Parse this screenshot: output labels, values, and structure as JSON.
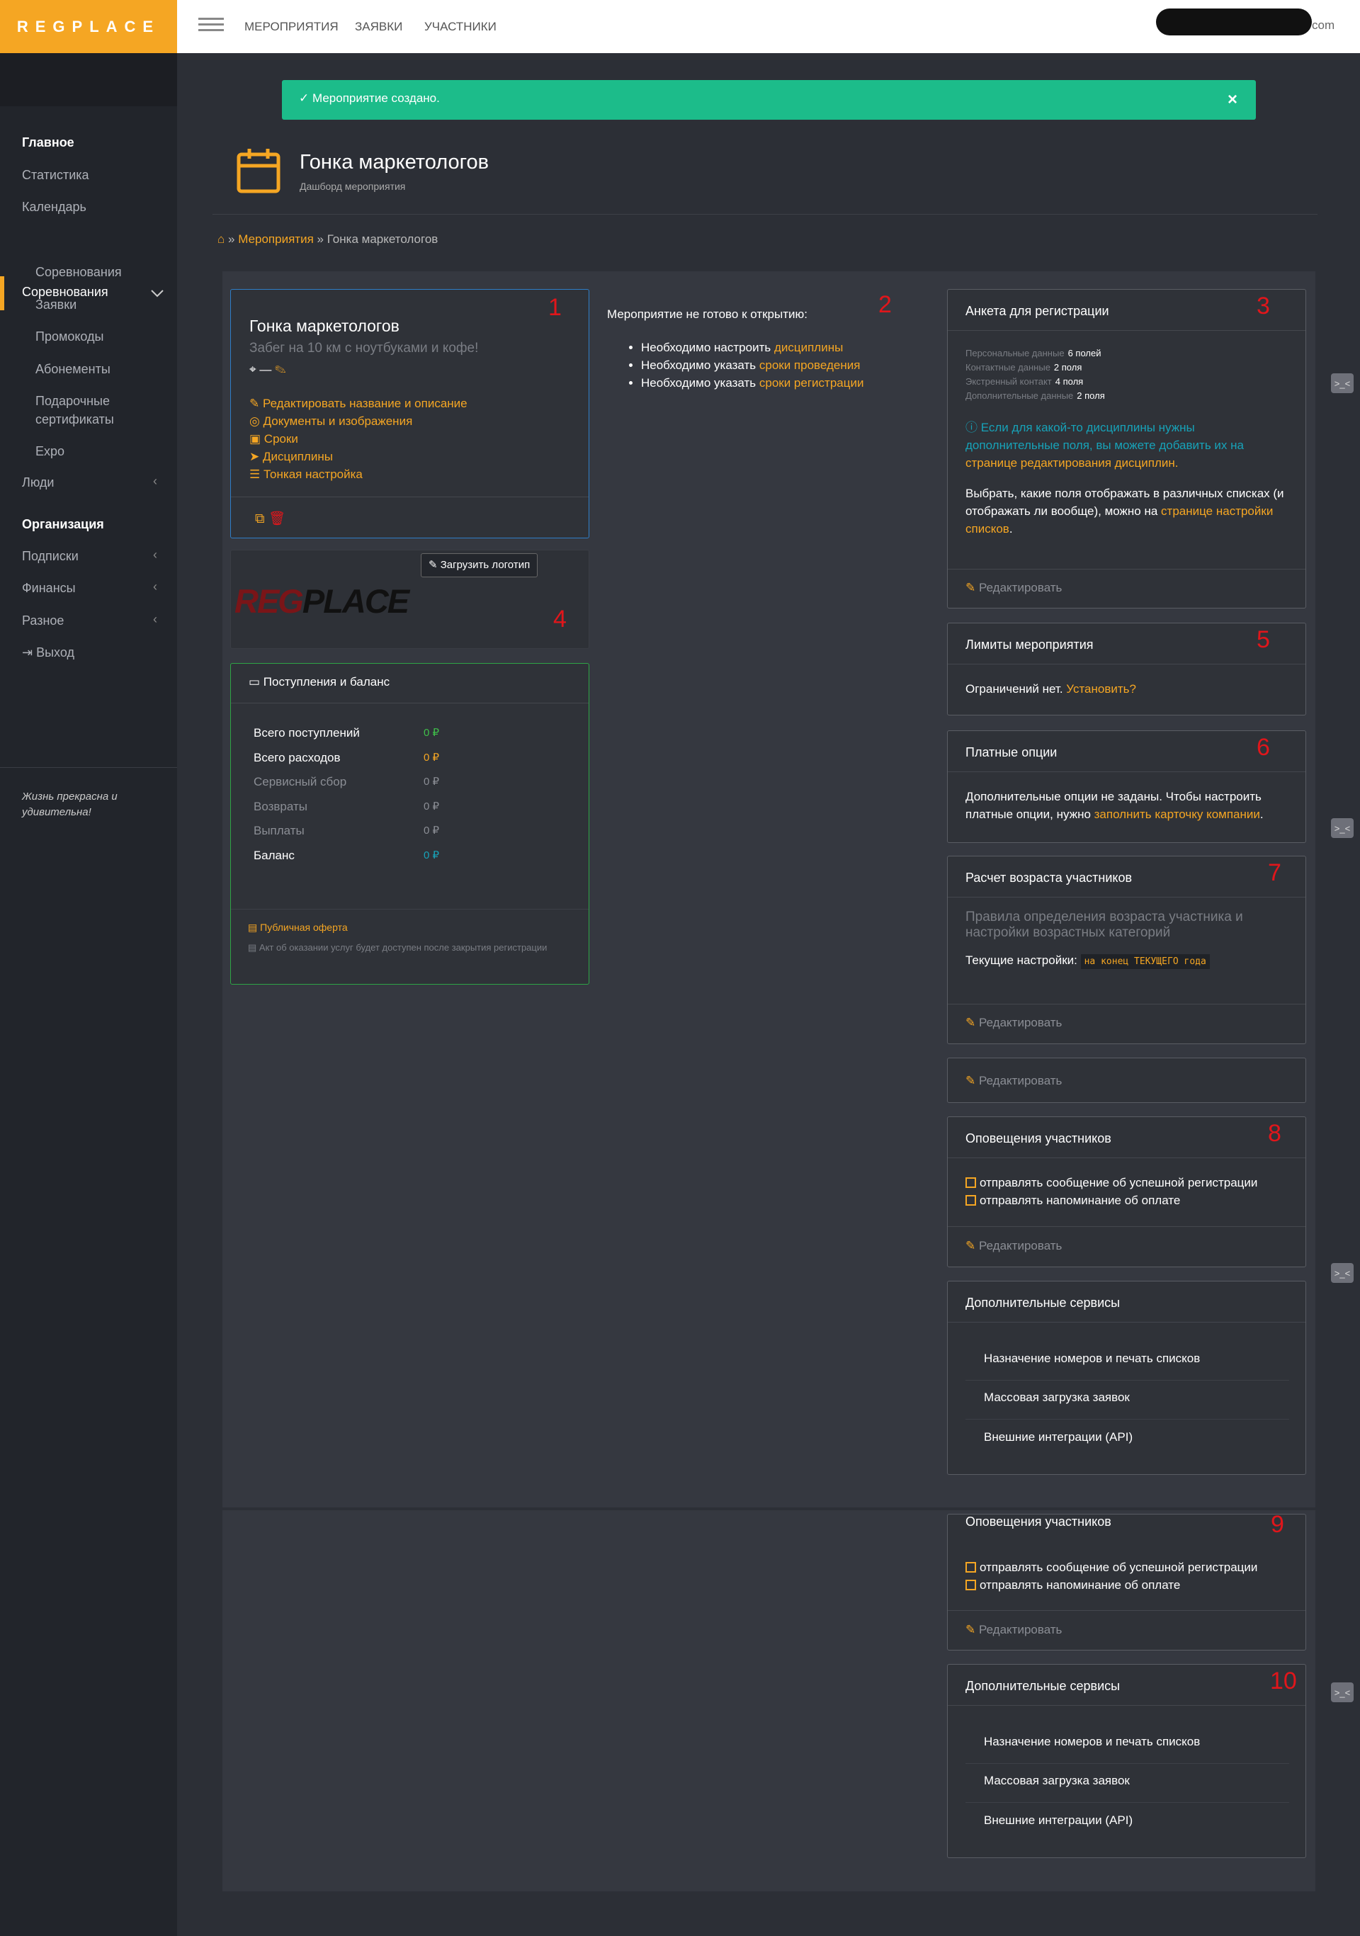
{
  "brand": {
    "logo_text": "REGPLACE",
    "accent": "#f5a623",
    "success": "#1cbc8a",
    "danger": "#e0161b"
  },
  "topnav": {
    "items": [
      "МЕРОПРИЯТИЯ",
      "ЗАЯВКИ",
      "УЧАСТНИКИ"
    ],
    "user_suffix": "com"
  },
  "sidebar": {
    "main": "Главное",
    "items": [
      "Статистика",
      "Календарь"
    ],
    "competitions": "Соревнования",
    "sub": [
      "Соревнования",
      "Заявки",
      "Промокоды",
      "Абонементы",
      "Подарочные сертификаты",
      "Expo"
    ],
    "people": "Люди",
    "org": "Организация",
    "org_items": [
      "Подписки",
      "Финансы",
      "Разное"
    ],
    "logout": "Выход",
    "footer": "Жизнь прекрасна и удивительна!"
  },
  "alert": {
    "text": "Мероприятие создано.",
    "close": "×"
  },
  "page": {
    "title": "Гонка маркетологов",
    "subtitle": "Дашборд мероприятия"
  },
  "breadcrumb": {
    "home_icon": "home-icon",
    "link": "Мероприятия",
    "current": "Гонка маркетологов",
    "sep": "»"
  },
  "event_card": {
    "title": "Гонка маркетологов",
    "desc": "Забег на 10 км с ноутбуками и кофе!",
    "location": "—",
    "links": [
      "Редактировать название и описание",
      "Документы и изображения",
      "Сроки",
      "Дисциплины",
      "Тонкая настройка"
    ]
  },
  "logo_card": {
    "upload_label": "Загрузить логотип",
    "logo_red": "REG",
    "logo_dark": "PLACE"
  },
  "balance": {
    "title": "Поступления и баланс",
    "rows": [
      {
        "label": "Всего поступлений",
        "value": "0 ₽",
        "color": "#3fbf4a"
      },
      {
        "label": "Всего расходов",
        "value": "0 ₽",
        "color": "#f5a623"
      },
      {
        "label": "Сервисный сбор",
        "value": "0 ₽",
        "color": "#8b8e95"
      },
      {
        "label": "Возвраты",
        "value": "0 ₽",
        "color": "#8b8e95"
      },
      {
        "label": "Выплаты",
        "value": "0 ₽",
        "color": "#8b8e95"
      },
      {
        "label": "Баланс",
        "value": "0 ₽",
        "color": "#17a2b8"
      }
    ],
    "offer": "Публичная оферта",
    "act": "Акт об оказании услуг будет доступен после закрытия регистрации"
  },
  "readiness": {
    "title": "Мероприятие не готово к открытию:",
    "items": [
      {
        "text": "Необходимо настроить ",
        "link": "дисциплины"
      },
      {
        "text": "Необходимо указать ",
        "link": "сроки проведения"
      },
      {
        "text": "Необходимо указать ",
        "link": "сроки регистрации"
      }
    ]
  },
  "form_card": {
    "title": "Анкета для регистрации",
    "fields": [
      {
        "label": "Персональные данные",
        "count": "6 полей"
      },
      {
        "label": "Контактные данные",
        "count": "2 поля"
      },
      {
        "label": "Экстренный контакт",
        "count": "4 поля"
      },
      {
        "label": "Дополнительные данные",
        "count": "2 поля"
      }
    ],
    "info": "Если для какой-то дисциплины нужны дополнительные поля, вы можете добавить их на ",
    "info_link": "странице редактирования дисциплин.",
    "lists_text": "Выбрать, какие поля отображать в различных списках (и отображать ли вообще), можно на ",
    "lists_link": "странице настройки списков",
    "lists_end": ".",
    "edit": "Редактировать"
  },
  "limits_card": {
    "title": "Лимиты мероприятия",
    "text": "Ограничений нет.",
    "link": "Установить?"
  },
  "paid_card": {
    "title": "Платные опции",
    "text": "Дополнительные опции не заданы. Чтобы настроить платные опции, нужно ",
    "link": "заполнить карточку компании",
    "end": "."
  },
  "age_card": {
    "title": "Расчет возраста участников",
    "desc": "Правила определения возраста участника и настройки возрастных категорий",
    "current_label": "Текущие настройки:",
    "current_value": "на конец ТЕКУЩЕГО года",
    "edit": "Редактировать"
  },
  "blank_card": {
    "edit": "Редактировать"
  },
  "notify_card": {
    "title": "Оповещения участников",
    "options": [
      "отправлять сообщение об успешной регистрации",
      "отправлять напоминание об оплате"
    ],
    "edit": "Редактировать"
  },
  "services_card": {
    "title": "Дополнительные сервисы",
    "items": [
      "Назначение номеров и печать списков",
      "Массовая загрузка заявок",
      "Внешние интеграции (API)"
    ]
  },
  "markers": [
    "1",
    "2",
    "3",
    "4",
    "5",
    "6",
    "7",
    "8",
    "9",
    "10"
  ],
  "handle_label": ">_<"
}
